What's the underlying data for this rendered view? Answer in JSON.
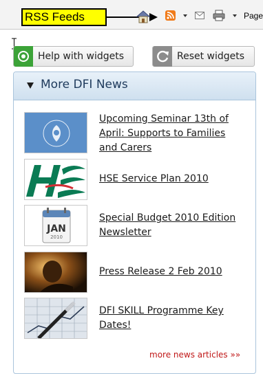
{
  "toolbar": {
    "annotation_label": "RSS Feeds",
    "page_label": "Page",
    "icons": [
      "home-icon",
      "rss-feed-icon",
      "mail-icon",
      "print-icon"
    ]
  },
  "widgets": {
    "help_label": "Help with widgets",
    "reset_label": "Reset widgets"
  },
  "panel": {
    "title": "More DFI News",
    "items": [
      {
        "title": "Upcoming Seminar 13th of April: Supports to Families and Carers",
        "thumb": "care-alliance-logo"
      },
      {
        "title": "HSE Service Plan 2010",
        "thumb": "hse-logo"
      },
      {
        "title": "Special Budget 2010 Edition Newsletter",
        "thumb": "calendar-jan-2010",
        "calendar_month": "JAN",
        "calendar_year": "2010"
      },
      {
        "title": "Press Release 2 Feb 2010",
        "thumb": "person-photo"
      },
      {
        "title": "DFI SKILL Programme Key Dates!",
        "thumb": "pen-on-chart-photo"
      }
    ],
    "more_label": "more news articles »»"
  },
  "colors": {
    "callout_bg": "#ffff00",
    "help_icon": "#3ca338",
    "panel_header": "#cfe0ef",
    "panel_title": "#1e3a5c",
    "more_link": "#c01818",
    "rss_orange": "#f07b1a"
  }
}
